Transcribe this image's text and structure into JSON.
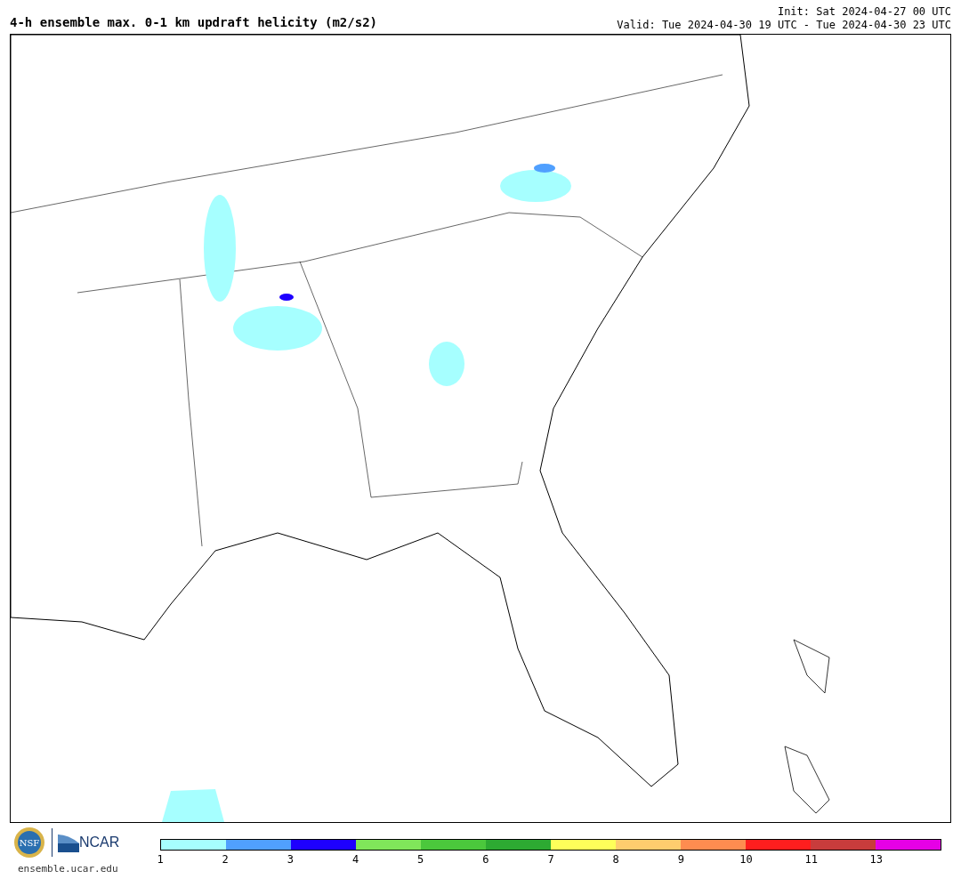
{
  "title": "4-h ensemble max. 0-1 km updraft helicity (m2/s2)",
  "init": "Init: Sat 2024-04-27 00 UTC",
  "valid": "Valid: Tue 2024-04-30 19 UTC - Tue 2024-04-30 23 UTC",
  "logos": {
    "nsf": "NSF",
    "ncar": "NCAR",
    "url": "ensemble.ucar.edu"
  },
  "colorbar": {
    "segments": [
      {
        "color": "#a6ffff"
      },
      {
        "color": "#50a0ff"
      },
      {
        "color": "#1e00ff"
      },
      {
        "color": "#80e65a"
      },
      {
        "color": "#4bc83c"
      },
      {
        "color": "#2daa32"
      },
      {
        "color": "#ffff5a"
      },
      {
        "color": "#ffcd6e"
      },
      {
        "color": "#ff8c50"
      },
      {
        "color": "#ff1e1e"
      },
      {
        "color": "#c83c3c"
      },
      {
        "color": "#e600e6"
      }
    ],
    "ticks": [
      "1",
      "2",
      "3",
      "4",
      "5",
      "6",
      "7",
      "8",
      "9",
      "10",
      "11",
      "13"
    ]
  }
}
